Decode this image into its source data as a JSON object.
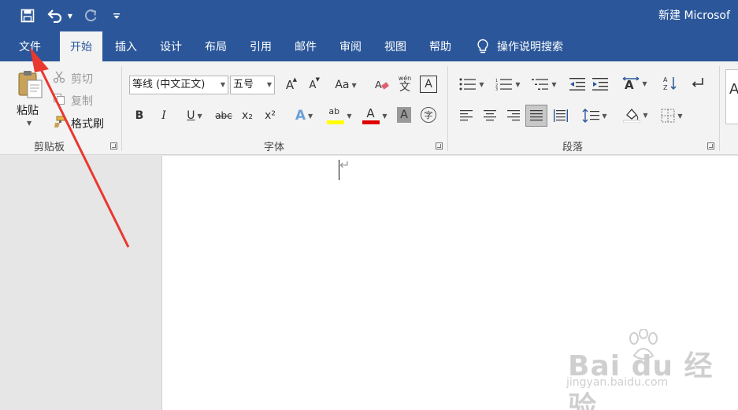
{
  "window": {
    "title": "新建 Microsof"
  },
  "quick_access": {
    "save_icon": "save-icon",
    "undo_icon": "undo-icon",
    "redo_icon": "redo-icon",
    "customize_icon": "customize-qat-icon"
  },
  "tabs": [
    {
      "label": "文件"
    },
    {
      "label": "开始"
    },
    {
      "label": "插入"
    },
    {
      "label": "设计"
    },
    {
      "label": "布局"
    },
    {
      "label": "引用"
    },
    {
      "label": "邮件"
    },
    {
      "label": "审阅"
    },
    {
      "label": "视图"
    },
    {
      "label": "帮助"
    }
  ],
  "active_tab": "开始",
  "tell_me": {
    "label": "操作说明搜索",
    "icon": "lightbulb-icon"
  },
  "clipboard": {
    "group_label": "剪贴板",
    "paste_label": "粘贴",
    "cut_label": "剪切",
    "copy_label": "复制",
    "format_painter_label": "格式刷"
  },
  "font": {
    "group_label": "字体",
    "font_name": "等线 (中文正文)",
    "font_size": "五号",
    "grow_glyph": "A",
    "shrink_glyph": "A",
    "case_glyph": "Aa",
    "phonetic_glyph": "wén",
    "phonetic_char": "文",
    "border_glyph": "A",
    "bold": "B",
    "italic": "I",
    "underline": "U",
    "strike": "abc",
    "subscript": "x₂",
    "superscript": "x²",
    "effects_glyph": "A",
    "highlight_glyph": "ab",
    "color_glyph": "A",
    "shading_glyph": "A",
    "enclose_glyph": "字",
    "highlight_color": "#ffff00",
    "font_color": "#e00000"
  },
  "paragraph": {
    "group_label": "段落"
  },
  "document": {
    "paragraph_mark": "↵"
  },
  "watermark": {
    "main": "Bai du 经验",
    "sub": "jingyan.baidu.com"
  },
  "annotation": {
    "color": "#e8382f"
  }
}
